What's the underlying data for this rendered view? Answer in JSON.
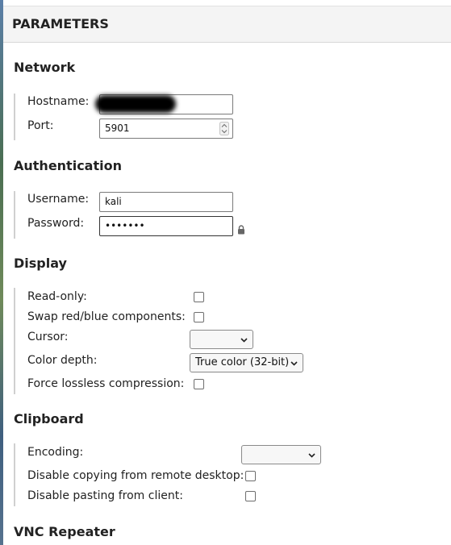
{
  "panel": {
    "title": "PARAMETERS"
  },
  "sections": {
    "network": {
      "title": "Network",
      "hostname_label": "Hostname:",
      "hostname_value": "",
      "port_label": "Port:",
      "port_value": "5901"
    },
    "authentication": {
      "title": "Authentication",
      "username_label": "Username:",
      "username_value": "kali",
      "password_label": "Password:",
      "password_value": "•••••••"
    },
    "display": {
      "title": "Display",
      "readonly_label": "Read-only:",
      "swap_label": "Swap red/blue components:",
      "cursor_label": "Cursor:",
      "cursor_value": "",
      "color_depth_label": "Color depth:",
      "color_depth_value": "True color (32-bit)",
      "lossless_label": "Force lossless compression:"
    },
    "clipboard": {
      "title": "Clipboard",
      "encoding_label": "Encoding:",
      "encoding_value": "",
      "disable_copy_label": "Disable copying from remote desktop:",
      "disable_paste_label": "Disable pasting from client:"
    },
    "vnc_repeater": {
      "title": "VNC Repeater"
    }
  },
  "icons": {
    "lock": "lock-icon",
    "spinner": "number-spinner-icon",
    "dropdown": "chevron-down-icon"
  },
  "colors": {
    "header_bg": "#f4f4f4",
    "group_rule": "#d0d0d0"
  }
}
